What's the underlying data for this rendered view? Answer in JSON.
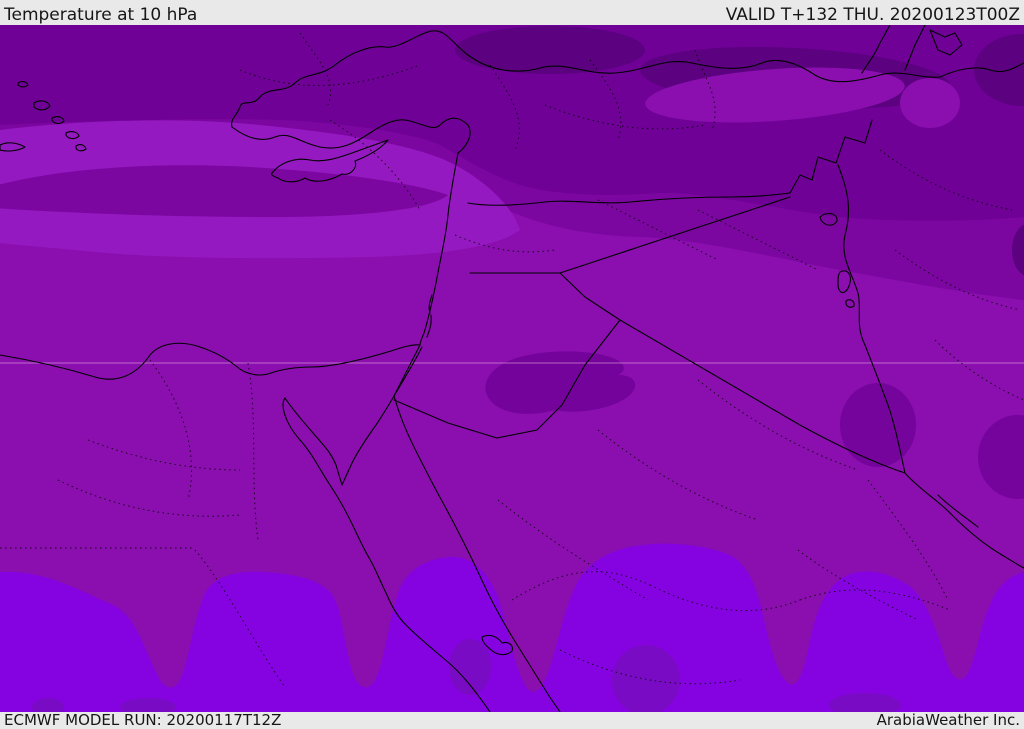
{
  "header": {
    "title": "Temperature at 10 hPa",
    "valid": "VALID T+132 THU. 20200123T00Z"
  },
  "footer": {
    "model_run": "ECMWF MODEL RUN: 20200117T12Z",
    "brand": "ArabiaWeather Inc."
  },
  "map": {
    "parameter": "Temperature at 10 hPa",
    "region": "Eastern Mediterranean / Middle East",
    "legend_note": "filled temperature contours, cold (dark purple) north to warmer (bright violet) south"
  },
  "colors": {
    "header-bg": "#e9e9e9",
    "header-text": "#161616",
    "band-darkest": "#5c0180",
    "band-dark": "#6f0197",
    "band-middark": "#7b07a0",
    "band-main": "#8a0fae",
    "band-light": "#9519c0",
    "band-violet": "#8503e0",
    "band-violet-dull": "#7a0bc4",
    "graticule": "#dd9ce0",
    "border-line": "#000000"
  }
}
